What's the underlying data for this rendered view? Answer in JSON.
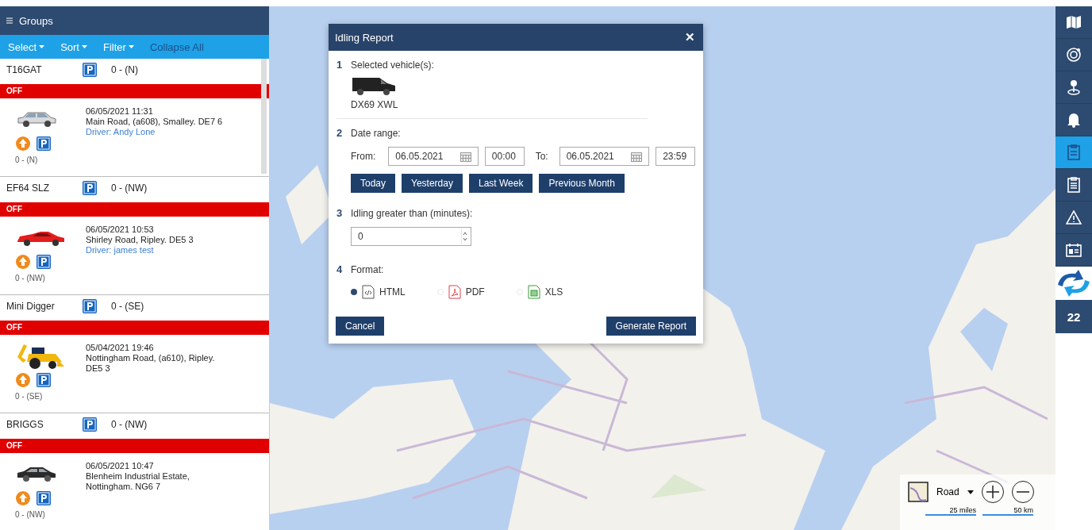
{
  "panel": {
    "title": "Groups",
    "toolbar": [
      {
        "label": "Select",
        "kind": "menu"
      },
      {
        "label": "Sort",
        "kind": "menu"
      },
      {
        "label": "Filter",
        "kind": "menu"
      },
      {
        "label": "Collapse All",
        "kind": "link"
      }
    ],
    "vehicles": [
      {
        "name": "T16GAT",
        "heading": "0 - (N)",
        "status": "OFF",
        "kind": "suv",
        "time": "06/05/2021 11:31",
        "address": "Main Road, (a608), Smalley. DE7 6",
        "driver": "Driver: Andy Lone",
        "heading_below": "0 - (N)"
      },
      {
        "name": "EF64 SLZ",
        "heading": "0 - (NW)",
        "status": "OFF",
        "kind": "sports",
        "time": "06/05/2021 10:53",
        "address": "Shirley Road, Ripley. DE5 3",
        "driver": "Driver: james test",
        "heading_below": "0 - (NW)"
      },
      {
        "name": "Mini Digger",
        "heading": "0 - (SE)",
        "status": "OFF",
        "kind": "digger",
        "time": "05/04/2021 19:46",
        "address": "Nottingham Road, (a610), Ripley. DE5 3",
        "heading_below": "0 - (SE)"
      },
      {
        "name": "BRIGGS",
        "heading": "0 - (NW)",
        "status": "OFF",
        "kind": "hatchback",
        "time": "06/05/2021 10:47",
        "address": "Blenheim Industrial Estate, Nottingham. NG6 7",
        "heading_below": "0 - (NW)"
      }
    ]
  },
  "dialog": {
    "title": "Idling Report",
    "close": "✕",
    "vehicle_section": {
      "number": "1",
      "label": "Selected vehicle(s):",
      "vehicle": "DX69 XWL"
    },
    "date_section": {
      "number": "2",
      "label": "Date range:",
      "from_label": "From:",
      "from_date": "06.05.2021",
      "from_time": "00:00",
      "to_label": "To:",
      "to_date": "06.05.2021",
      "to_time": "23:59",
      "presets": [
        "Today",
        "Yesterday",
        "Last Week",
        "Previous Month"
      ]
    },
    "idle_section": {
      "number": "3",
      "label": "Idling greater than (minutes):",
      "value": "0"
    },
    "format_section": {
      "number": "4",
      "label": "Format:",
      "formats": [
        {
          "label": "HTML",
          "kind": "html",
          "selected": true
        },
        {
          "label": "PDF",
          "kind": "pdf",
          "selected": false
        },
        {
          "label": "XLS",
          "kind": "xls",
          "selected": false
        }
      ]
    },
    "buttons": {
      "cancel": "Cancel",
      "submit": "Generate Report"
    }
  },
  "map": {
    "kind": "picture",
    "layer": "Road",
    "scale_miles": "25 miles",
    "scale_km": "50 km"
  },
  "rail": {
    "items": [
      {
        "kind": "map",
        "selected": false
      },
      {
        "kind": "target",
        "selected": false
      },
      {
        "kind": "pin",
        "selected": false
      },
      {
        "kind": "bell",
        "selected": false
      },
      {
        "kind": "report",
        "selected": true
      },
      {
        "kind": "clipboard",
        "selected": false
      },
      {
        "kind": "warning",
        "selected": false
      },
      {
        "kind": "calendar",
        "selected": false
      }
    ],
    "count": "22"
  }
}
